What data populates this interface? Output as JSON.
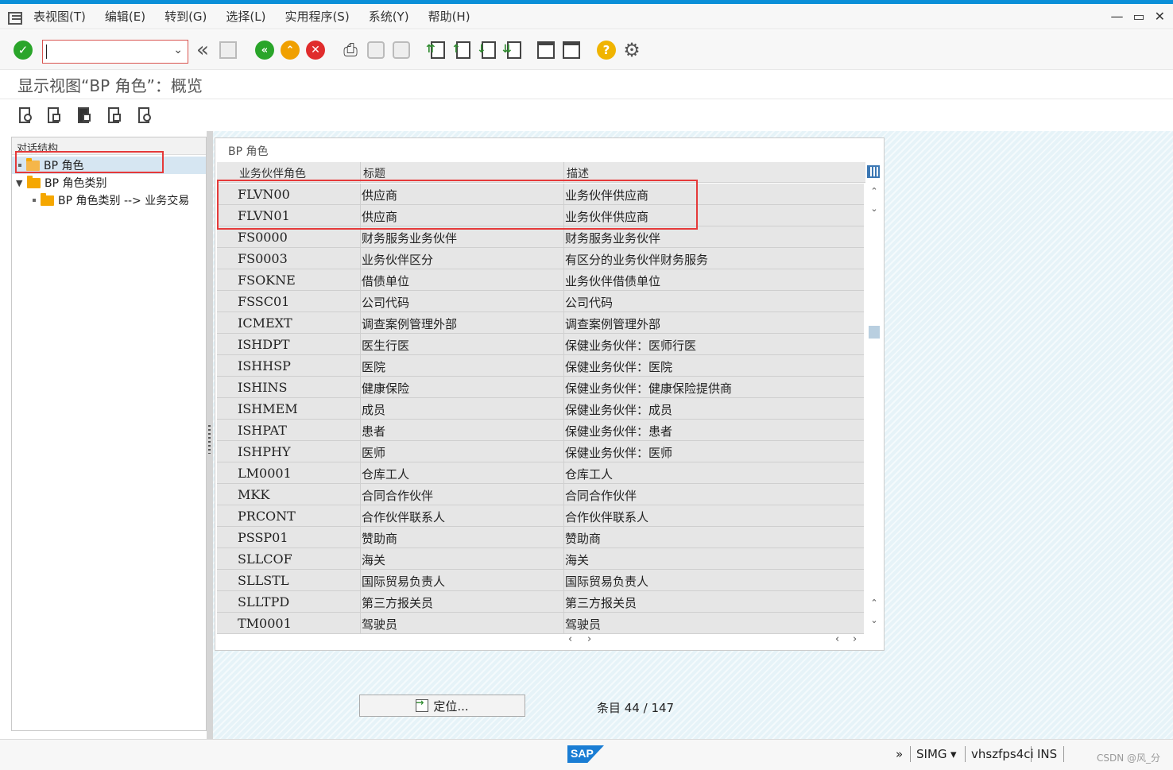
{
  "menubar": {
    "items": [
      "表视图(T)",
      "编辑(E)",
      "转到(G)",
      "选择(L)",
      "实用程序(S)",
      "系统(Y)",
      "帮助(H)"
    ],
    "window_controls": [
      "—",
      "▭",
      "✕"
    ]
  },
  "toolbar": {
    "command_field_value": "",
    "icons": [
      "check-icon",
      "save-icon",
      "back-icon",
      "exit-icon",
      "cancel-icon",
      "print-icon",
      "find-icon",
      "find-next-icon",
      "first-page-icon",
      "prev-page-icon",
      "next-page-icon",
      "last-page-icon",
      "create-session-icon",
      "shortcut-icon",
      "help-icon",
      "settings-icon"
    ]
  },
  "title": "显示视图“BP 角色”：概览",
  "tree": {
    "header": "对话结构",
    "items": [
      {
        "label": "BP 角色",
        "selected": true
      },
      {
        "label": "BP 角色类别",
        "selected": false
      },
      {
        "label": "BP 角色类别 --> 业务交易",
        "selected": false
      }
    ]
  },
  "table": {
    "title": "BP 角色",
    "columns": [
      "业务伙伴角色",
      "标题",
      "描述"
    ],
    "rows": [
      {
        "role": "FLVN00",
        "title": "供应商",
        "desc": "业务伙伴供应商"
      },
      {
        "role": "FLVN01",
        "title": "供应商",
        "desc": "业务伙伴供应商"
      },
      {
        "role": "FS0000",
        "title": "财务服务业务伙伴",
        "desc": "财务服务业务伙伴"
      },
      {
        "role": "FS0003",
        "title": "业务伙伴区分",
        "desc": "有区分的业务伙伴财务服务"
      },
      {
        "role": "FSOKNE",
        "title": "借债单位",
        "desc": "业务伙伴借债单位"
      },
      {
        "role": "FSSC01",
        "title": "公司代码",
        "desc": "公司代码"
      },
      {
        "role": "ICMEXT",
        "title": "调查案例管理外部",
        "desc": "调查案例管理外部"
      },
      {
        "role": "ISHDPT",
        "title": "医生行医",
        "desc": "保健业务伙伴：医师行医"
      },
      {
        "role": "ISHHSP",
        "title": "医院",
        "desc": "保健业务伙伴：医院"
      },
      {
        "role": "ISHINS",
        "title": "健康保险",
        "desc": "保健业务伙伴：健康保险提供商"
      },
      {
        "role": "ISHMEM",
        "title": "成员",
        "desc": "保健业务伙伴：成员"
      },
      {
        "role": "ISHPAT",
        "title": "患者",
        "desc": "保健业务伙伴：患者"
      },
      {
        "role": "ISHPHY",
        "title": "医师",
        "desc": "保健业务伙伴：医师"
      },
      {
        "role": "LM0001",
        "title": "仓库工人",
        "desc": "仓库工人"
      },
      {
        "role": "MKK",
        "title": "合同合作伙伴",
        "desc": "合同合作伙伴"
      },
      {
        "role": "PRCONT",
        "title": "合作伙伴联系人",
        "desc": "合作伙伴联系人"
      },
      {
        "role": "PSSP01",
        "title": "赞助商",
        "desc": "赞助商"
      },
      {
        "role": "SLLCOF",
        "title": "海关",
        "desc": "海关"
      },
      {
        "role": "SLLSTL",
        "title": "国际贸易负责人",
        "desc": "国际贸易负责人"
      },
      {
        "role": "SLLTPD",
        "title": "第三方报关员",
        "desc": "第三方报关员"
      },
      {
        "role": "TM0001",
        "title": "驾驶员",
        "desc": "驾驶员"
      }
    ]
  },
  "position_button": "定位...",
  "entry_count": "条目 44 / 147",
  "statusbar": {
    "logo_text": "SAP",
    "nav_arrows": "»",
    "system": "SIMG",
    "dropdown": "▾",
    "server": "vhszfps4ci",
    "mode": "INS",
    "watermark": "CSDN @风_分"
  },
  "colors": {
    "accent": "#0a8fd8",
    "highlight_box": "#e53a3a",
    "ok_green": "#2aa52a",
    "back_green": "#2aa52a",
    "exit_orange": "#f0a000",
    "cancel_red": "#e02c2c",
    "help_yellow": "#f0b400"
  }
}
